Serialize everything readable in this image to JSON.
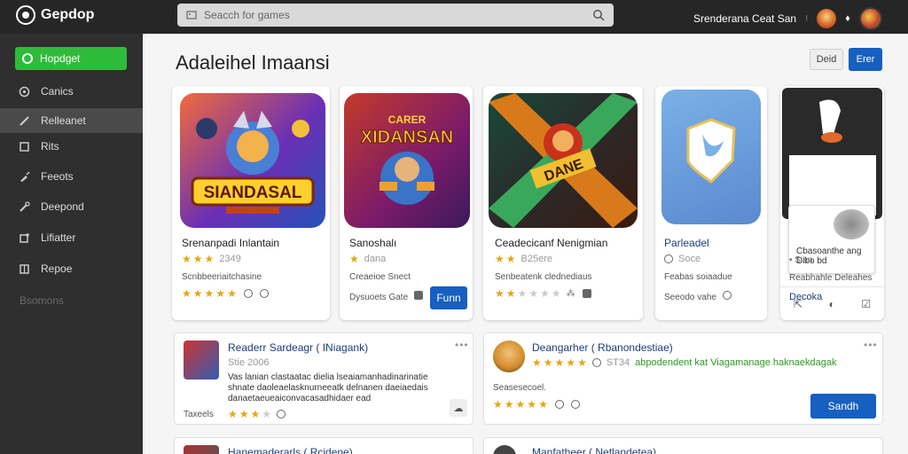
{
  "app": {
    "name": "Gepdop"
  },
  "search": {
    "placeholder": "Seacch for games"
  },
  "user": {
    "name": "Srenderana Ceat San"
  },
  "sidebar": {
    "new_label": "Hopdget",
    "items": [
      {
        "label": "Canics",
        "icon": "circle-icon"
      },
      {
        "label": "Relleanet",
        "icon": "pencil-icon",
        "active": true
      },
      {
        "label": "Rits",
        "icon": "square-icon"
      },
      {
        "label": "Feeots",
        "icon": "brush-icon"
      },
      {
        "label": "Deepond",
        "icon": "wrench-icon"
      },
      {
        "label": "Lifiatter",
        "icon": "puzzle-icon"
      },
      {
        "label": "Repoe",
        "icon": "box-icon"
      }
    ],
    "muted_label": "Bsomons"
  },
  "main": {
    "title": "Adaleihel Imaansi",
    "edit_label": "Deid",
    "new_label": "Erer"
  },
  "cards": [
    {
      "name": "Srenanpadi Inlantain",
      "rating_text": "2349",
      "sub": "Scnbbeeriaitchasine",
      "stars": 3
    },
    {
      "name": "Sanoshalı",
      "rating_text": "dana",
      "sub": "Creaeioe Snect",
      "foot": "Dysuoets Gate",
      "button": "Funn"
    },
    {
      "name": "Ceadecicanf Nenigmian",
      "rating_text": "B25ere",
      "sub": "Senbeatenk clednediaus",
      "stars": 2
    },
    {
      "name": "Parleadel",
      "rating_text": "Soce",
      "sub": "Feabas soiaadue",
      "foot": "Seeodo vahe"
    },
    {
      "name": "Decoka",
      "rating_text": "Sian",
      "sub": "Reabhahle Deleahes",
      "popup_text": "Cbasoanthe ang\nDibo bd"
    }
  ],
  "art_text": {
    "card1_logo": "SIANDASAL",
    "card2_title_top": "CARER",
    "card2_title": "XIDANSAN",
    "card3_text": "DANE"
  },
  "rows": [
    {
      "title": "Readerr Sardeagr ( INiagank)",
      "rating_text": "Stie 2006",
      "desc": "Vas lanian clastaatac dielia lseaiamanhadinarinatie shnate daoleaelasknurneeatk delnanen daeiaedais danaetaeueaiconvacasadhidaer ead",
      "foot": "Taxeels"
    },
    {
      "title": "Deangarher ( Rbanondestiae)",
      "rating_text": "ST34",
      "highlight": "abpodendent kat Viagamanage haknaekdagak",
      "desc": "Seasesecoel.",
      "button": "Sandh"
    }
  ],
  "rows_peek": [
    {
      "title": "Hanemaderarls ( Rcidene)"
    },
    {
      "title": "Manfatheer ( Netlandetea)"
    }
  ]
}
